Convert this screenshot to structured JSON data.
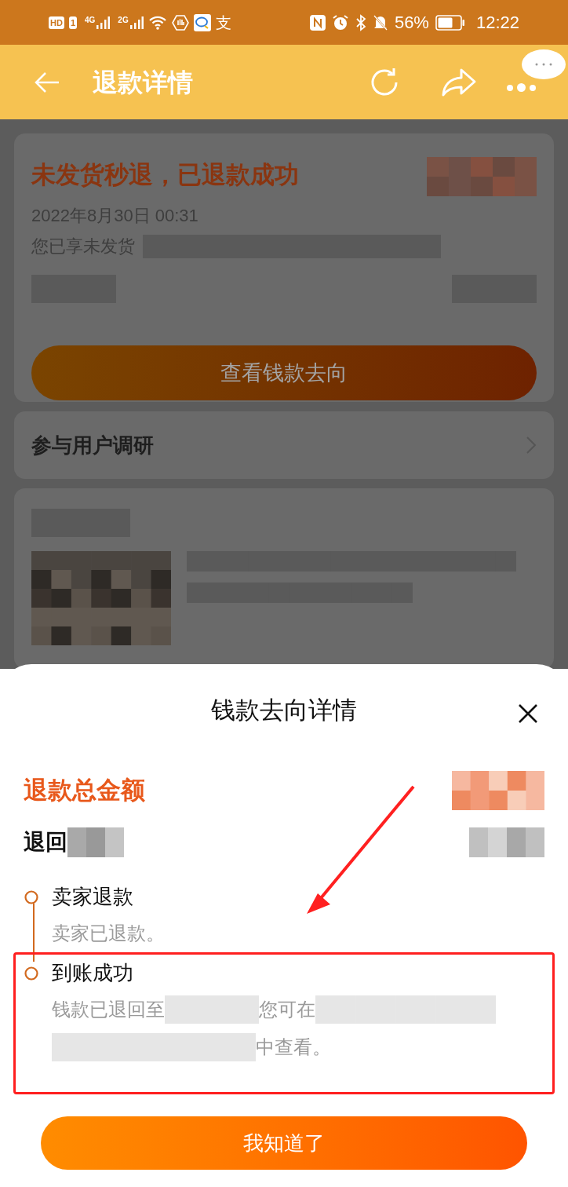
{
  "status_bar": {
    "badges": [
      "HD",
      "1"
    ],
    "signals": [
      "4G",
      "2G"
    ],
    "app_glyph": "支",
    "battery": "56%",
    "time": "12:22"
  },
  "header": {
    "title": "退款详情"
  },
  "background_page": {
    "status_card": {
      "title": "未发货秒退，已退款成功",
      "date": "2022年8月30日 00:31",
      "note": "您已享未发货",
      "button": "查看钱款去向"
    },
    "survey": {
      "label": "参与用户调研"
    }
  },
  "sheet": {
    "title": "钱款去向详情",
    "total_label": "退款总金额",
    "returned_label": "退回",
    "steps": [
      {
        "title": "卖家退款",
        "highlighted": false,
        "lines": [
          [
            {
              "kind": "text",
              "text": "卖家已退款。"
            }
          ]
        ]
      },
      {
        "title": "到账成功",
        "highlighted": true,
        "lines": [
          [
            {
              "kind": "text",
              "text": "钱款已退回至"
            },
            {
              "kind": "redacted"
            },
            {
              "kind": "text",
              "text": "您可在"
            },
            {
              "kind": "redacted"
            }
          ],
          [
            {
              "kind": "redacted"
            },
            {
              "kind": "text",
              "text": "中查看。"
            }
          ]
        ]
      }
    ],
    "button": "我知道了"
  }
}
